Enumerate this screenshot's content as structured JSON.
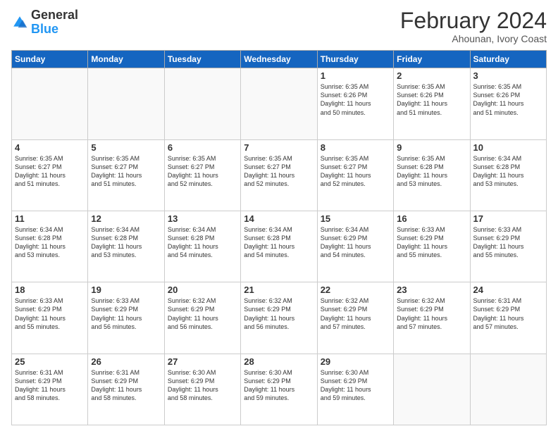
{
  "header": {
    "logo": {
      "general": "General",
      "blue": "Blue"
    },
    "title": "February 2024",
    "subtitle": "Ahounan, Ivory Coast"
  },
  "weekdays": [
    "Sunday",
    "Monday",
    "Tuesday",
    "Wednesday",
    "Thursday",
    "Friday",
    "Saturday"
  ],
  "weeks": [
    [
      {
        "day": null,
        "info": null
      },
      {
        "day": null,
        "info": null
      },
      {
        "day": null,
        "info": null
      },
      {
        "day": null,
        "info": null
      },
      {
        "day": "1",
        "info": "Sunrise: 6:35 AM\nSunset: 6:26 PM\nDaylight: 11 hours\nand 50 minutes."
      },
      {
        "day": "2",
        "info": "Sunrise: 6:35 AM\nSunset: 6:26 PM\nDaylight: 11 hours\nand 51 minutes."
      },
      {
        "day": "3",
        "info": "Sunrise: 6:35 AM\nSunset: 6:26 PM\nDaylight: 11 hours\nand 51 minutes."
      }
    ],
    [
      {
        "day": "4",
        "info": "Sunrise: 6:35 AM\nSunset: 6:27 PM\nDaylight: 11 hours\nand 51 minutes."
      },
      {
        "day": "5",
        "info": "Sunrise: 6:35 AM\nSunset: 6:27 PM\nDaylight: 11 hours\nand 51 minutes."
      },
      {
        "day": "6",
        "info": "Sunrise: 6:35 AM\nSunset: 6:27 PM\nDaylight: 11 hours\nand 52 minutes."
      },
      {
        "day": "7",
        "info": "Sunrise: 6:35 AM\nSunset: 6:27 PM\nDaylight: 11 hours\nand 52 minutes."
      },
      {
        "day": "8",
        "info": "Sunrise: 6:35 AM\nSunset: 6:27 PM\nDaylight: 11 hours\nand 52 minutes."
      },
      {
        "day": "9",
        "info": "Sunrise: 6:35 AM\nSunset: 6:28 PM\nDaylight: 11 hours\nand 53 minutes."
      },
      {
        "day": "10",
        "info": "Sunrise: 6:34 AM\nSunset: 6:28 PM\nDaylight: 11 hours\nand 53 minutes."
      }
    ],
    [
      {
        "day": "11",
        "info": "Sunrise: 6:34 AM\nSunset: 6:28 PM\nDaylight: 11 hours\nand 53 minutes."
      },
      {
        "day": "12",
        "info": "Sunrise: 6:34 AM\nSunset: 6:28 PM\nDaylight: 11 hours\nand 53 minutes."
      },
      {
        "day": "13",
        "info": "Sunrise: 6:34 AM\nSunset: 6:28 PM\nDaylight: 11 hours\nand 54 minutes."
      },
      {
        "day": "14",
        "info": "Sunrise: 6:34 AM\nSunset: 6:28 PM\nDaylight: 11 hours\nand 54 minutes."
      },
      {
        "day": "15",
        "info": "Sunrise: 6:34 AM\nSunset: 6:29 PM\nDaylight: 11 hours\nand 54 minutes."
      },
      {
        "day": "16",
        "info": "Sunrise: 6:33 AM\nSunset: 6:29 PM\nDaylight: 11 hours\nand 55 minutes."
      },
      {
        "day": "17",
        "info": "Sunrise: 6:33 AM\nSunset: 6:29 PM\nDaylight: 11 hours\nand 55 minutes."
      }
    ],
    [
      {
        "day": "18",
        "info": "Sunrise: 6:33 AM\nSunset: 6:29 PM\nDaylight: 11 hours\nand 55 minutes."
      },
      {
        "day": "19",
        "info": "Sunrise: 6:33 AM\nSunset: 6:29 PM\nDaylight: 11 hours\nand 56 minutes."
      },
      {
        "day": "20",
        "info": "Sunrise: 6:32 AM\nSunset: 6:29 PM\nDaylight: 11 hours\nand 56 minutes."
      },
      {
        "day": "21",
        "info": "Sunrise: 6:32 AM\nSunset: 6:29 PM\nDaylight: 11 hours\nand 56 minutes."
      },
      {
        "day": "22",
        "info": "Sunrise: 6:32 AM\nSunset: 6:29 PM\nDaylight: 11 hours\nand 57 minutes."
      },
      {
        "day": "23",
        "info": "Sunrise: 6:32 AM\nSunset: 6:29 PM\nDaylight: 11 hours\nand 57 minutes."
      },
      {
        "day": "24",
        "info": "Sunrise: 6:31 AM\nSunset: 6:29 PM\nDaylight: 11 hours\nand 57 minutes."
      }
    ],
    [
      {
        "day": "25",
        "info": "Sunrise: 6:31 AM\nSunset: 6:29 PM\nDaylight: 11 hours\nand 58 minutes."
      },
      {
        "day": "26",
        "info": "Sunrise: 6:31 AM\nSunset: 6:29 PM\nDaylight: 11 hours\nand 58 minutes."
      },
      {
        "day": "27",
        "info": "Sunrise: 6:30 AM\nSunset: 6:29 PM\nDaylight: 11 hours\nand 58 minutes."
      },
      {
        "day": "28",
        "info": "Sunrise: 6:30 AM\nSunset: 6:29 PM\nDaylight: 11 hours\nand 59 minutes."
      },
      {
        "day": "29",
        "info": "Sunrise: 6:30 AM\nSunset: 6:29 PM\nDaylight: 11 hours\nand 59 minutes."
      },
      {
        "day": null,
        "info": null
      },
      {
        "day": null,
        "info": null
      }
    ]
  ]
}
